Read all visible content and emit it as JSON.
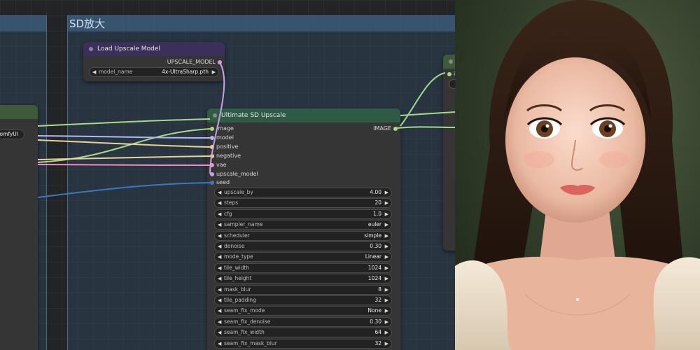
{
  "group": {
    "title": "SD放大"
  },
  "load_node": {
    "title": "Load Upscale Model",
    "output_label": "UPSCALE_MODEL",
    "widget": {
      "label": "model_name",
      "value": "4x-UltraSharp.pth"
    }
  },
  "left_node": {
    "widget_value": "ComfyUI"
  },
  "right_node": {
    "input_label": "i"
  },
  "usu_node": {
    "title": "Ultimate SD Upscale",
    "output_label": "IMAGE",
    "inputs": [
      {
        "label": "image",
        "color": "#a8d98a"
      },
      {
        "label": "model",
        "color": "#b0b8f0"
      },
      {
        "label": "positive",
        "color": "#e8d49a"
      },
      {
        "label": "negative",
        "color": "#e8d49a"
      },
      {
        "label": "vae",
        "color": "#f08cc8"
      },
      {
        "label": "upscale_model",
        "color": "#c8a0e8"
      },
      {
        "label": "seed",
        "color": "#3c78c0"
      }
    ],
    "widgets": [
      {
        "label": "upscale_by",
        "value": "4.00"
      },
      {
        "label": "steps",
        "value": "20"
      },
      {
        "label": "cfg",
        "value": "1.0"
      },
      {
        "label": "sampler_name",
        "value": "euler"
      },
      {
        "label": "scheduler",
        "value": "simple"
      },
      {
        "label": "denoise",
        "value": "0.30"
      },
      {
        "label": "mode_type",
        "value": "Linear"
      },
      {
        "label": "tile_width",
        "value": "1024"
      },
      {
        "label": "tile_height",
        "value": "1024"
      },
      {
        "label": "mask_blur",
        "value": "8"
      },
      {
        "label": "tile_padding",
        "value": "32"
      },
      {
        "label": "seam_fix_mode",
        "value": "None"
      },
      {
        "label": "seam_fix_denoise",
        "value": "0.30"
      },
      {
        "label": "seam_fix_width",
        "value": "64"
      },
      {
        "label": "seam_fix_mask_blur",
        "value": "32"
      }
    ]
  },
  "colors": {
    "image_wire": "#a8d98a",
    "model_wire": "#b0b8f0",
    "conditioning_wire": "#e8d49a",
    "vae_wire": "#f08cc8",
    "upscale_model_wire": "#c8a0e8",
    "seed_wire": "#3c78c0",
    "load_title": "#3d2f5c",
    "usu_title": "#2f5a45"
  }
}
